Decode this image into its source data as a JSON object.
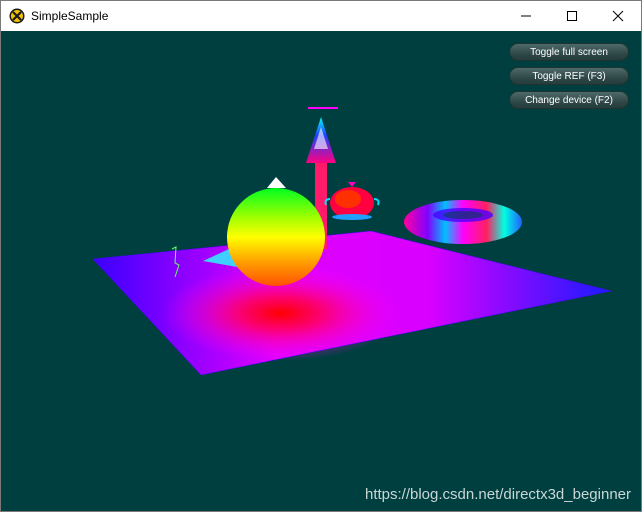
{
  "window": {
    "title": "SimpleSample",
    "icon": "directx-logo-icon",
    "controls": [
      "minimize-icon",
      "maximize-icon",
      "close-icon"
    ]
  },
  "viewport": {
    "background_color": "#003f40"
  },
  "hud": {
    "toggle_fullscreen_label": "Toggle full screen",
    "toggle_ref_label": "Toggle REF (F3)",
    "change_device_label": "Change device (F2)"
  },
  "watermark": "https://blog.csdn.net/directx3d_beginner"
}
